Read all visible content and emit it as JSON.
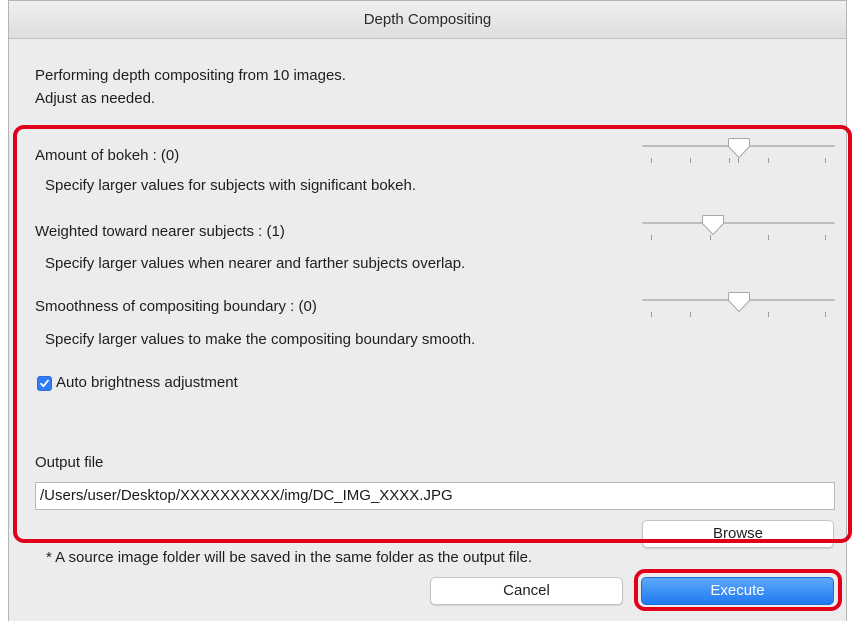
{
  "window": {
    "title": "Depth Compositing"
  },
  "intro": {
    "line1": "Performing depth compositing from 10 images.",
    "line2": "Adjust as needed."
  },
  "settings": {
    "bokeh": {
      "label": "Amount of bokeh : (0)",
      "description": "Specify larger values for subjects with significant bokeh.",
      "value_fraction": 0.5
    },
    "nearer": {
      "label": "Weighted toward nearer subjects : (1)",
      "description": "Specify larger values when nearer and farther subjects overlap.",
      "value_fraction": 0.35
    },
    "smoothness": {
      "label": "Smoothness of compositing boundary : (0)",
      "description": "Specify larger values to make the compositing boundary smooth.",
      "value_fraction": 0.5
    },
    "auto_brightness": {
      "label": "Auto brightness adjustment",
      "checked": true
    }
  },
  "output": {
    "label": "Output file",
    "path": "/Users/user/Desktop/XXXXXXXXXX/img/DC_IMG_XXXX.JPG",
    "browse_label": "Browse"
  },
  "note": "* A source image folder will be saved in the same folder as the output file.",
  "buttons": {
    "cancel": "Cancel",
    "execute": "Execute"
  },
  "colors": {
    "highlight": "#e0001a",
    "accent": "#1f7af2"
  }
}
